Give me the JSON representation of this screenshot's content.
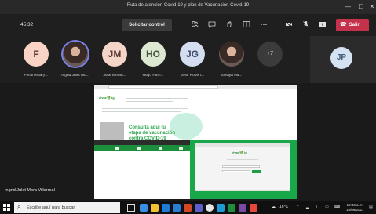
{
  "window": {
    "title": "Ruta de atención Covid-19 y plan de Vacunación Covid-19",
    "minimize_glyph": "—",
    "maximize_glyph": "☐",
    "close_glyph": "✕"
  },
  "toolbar": {
    "timer": "45:32",
    "request_control_label": "Solicitar control",
    "leave_label": "Salir",
    "leave_color": "#c4314b"
  },
  "participants": [
    {
      "initials": "F",
      "name": "Fecomeda (I...",
      "avatar_color": "#f8d3c6",
      "type": "initials"
    },
    {
      "initials": "",
      "name": "Ingrid Julet Mo...",
      "type": "photo",
      "active": true
    },
    {
      "initials": "JM",
      "name": "Jose fernan...",
      "avatar_color": "#f6d5c9",
      "type": "initials"
    },
    {
      "initials": "HO",
      "name": "Hugo Hum...",
      "avatar_color": "#dde8d3",
      "type": "initials"
    },
    {
      "initials": "JG",
      "name": "José Ruben...",
      "avatar_color": "#d5def0",
      "type": "initials"
    },
    {
      "initials": "",
      "name": "Soraya Hu...",
      "type": "photo"
    }
  ],
  "more_participants": "+7",
  "self_view": {
    "initials": "JP"
  },
  "shared_screen": {
    "logo_text": "elvac🌿 ig",
    "cta_line1": "Consulta aquí tu",
    "cta_line2": "etapa de vacunación",
    "cta_line3": "contra COVID-19",
    "card_logo": "elvac🌿 ig",
    "presenter_name": "Ingrid Julet Mora Villarreal"
  },
  "taskbar": {
    "search_placeholder": "Escribe aquí para buscar",
    "temperature": "16°C",
    "time": "10:36 a.m.",
    "date": "16/06/2021"
  }
}
